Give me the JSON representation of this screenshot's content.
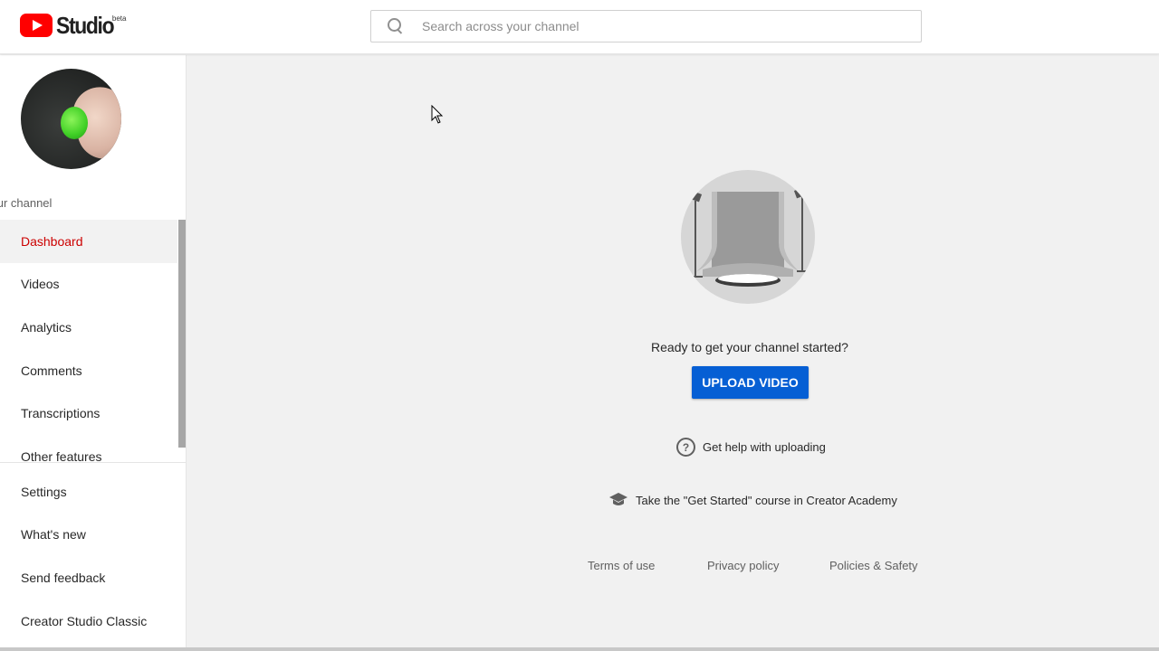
{
  "app": {
    "logo_text": "Studio",
    "logo_badge": "beta"
  },
  "search": {
    "placeholder": "Search across your channel",
    "value": ""
  },
  "sidebar": {
    "channel_label": "Your channel",
    "items": [
      {
        "label": "Dashboard",
        "icon": "dashboard-icon",
        "active": true
      },
      {
        "label": "Videos",
        "icon": "videos-icon",
        "active": false
      },
      {
        "label": "Analytics",
        "icon": "analytics-icon",
        "active": false
      },
      {
        "label": "Comments",
        "icon": "comments-icon",
        "active": false
      },
      {
        "label": "Transcriptions",
        "icon": "transcriptions-icon",
        "active": false
      },
      {
        "label": "Other features",
        "icon": "other-features-icon",
        "active": false
      }
    ],
    "bottom_items": [
      {
        "label": "Settings",
        "icon": "settings-icon"
      },
      {
        "label": "What's new",
        "icon": "whats-new-icon"
      },
      {
        "label": "Send feedback",
        "icon": "feedback-icon"
      },
      {
        "label": "Creator Studio Classic",
        "icon": "classic-icon"
      }
    ]
  },
  "main": {
    "ready_text": "Ready to get your channel started?",
    "upload_button": "UPLOAD VIDEO",
    "help_link": "Get help with uploading",
    "course_link": "Take the \"Get Started\" course in Creator Academy",
    "footer": {
      "terms": "Terms of use",
      "privacy": "Privacy policy",
      "policies": "Policies & Safety"
    }
  },
  "colors": {
    "brand_red": "#ff0000",
    "active_nav": "#cc0000",
    "primary_button": "#065fd4"
  }
}
